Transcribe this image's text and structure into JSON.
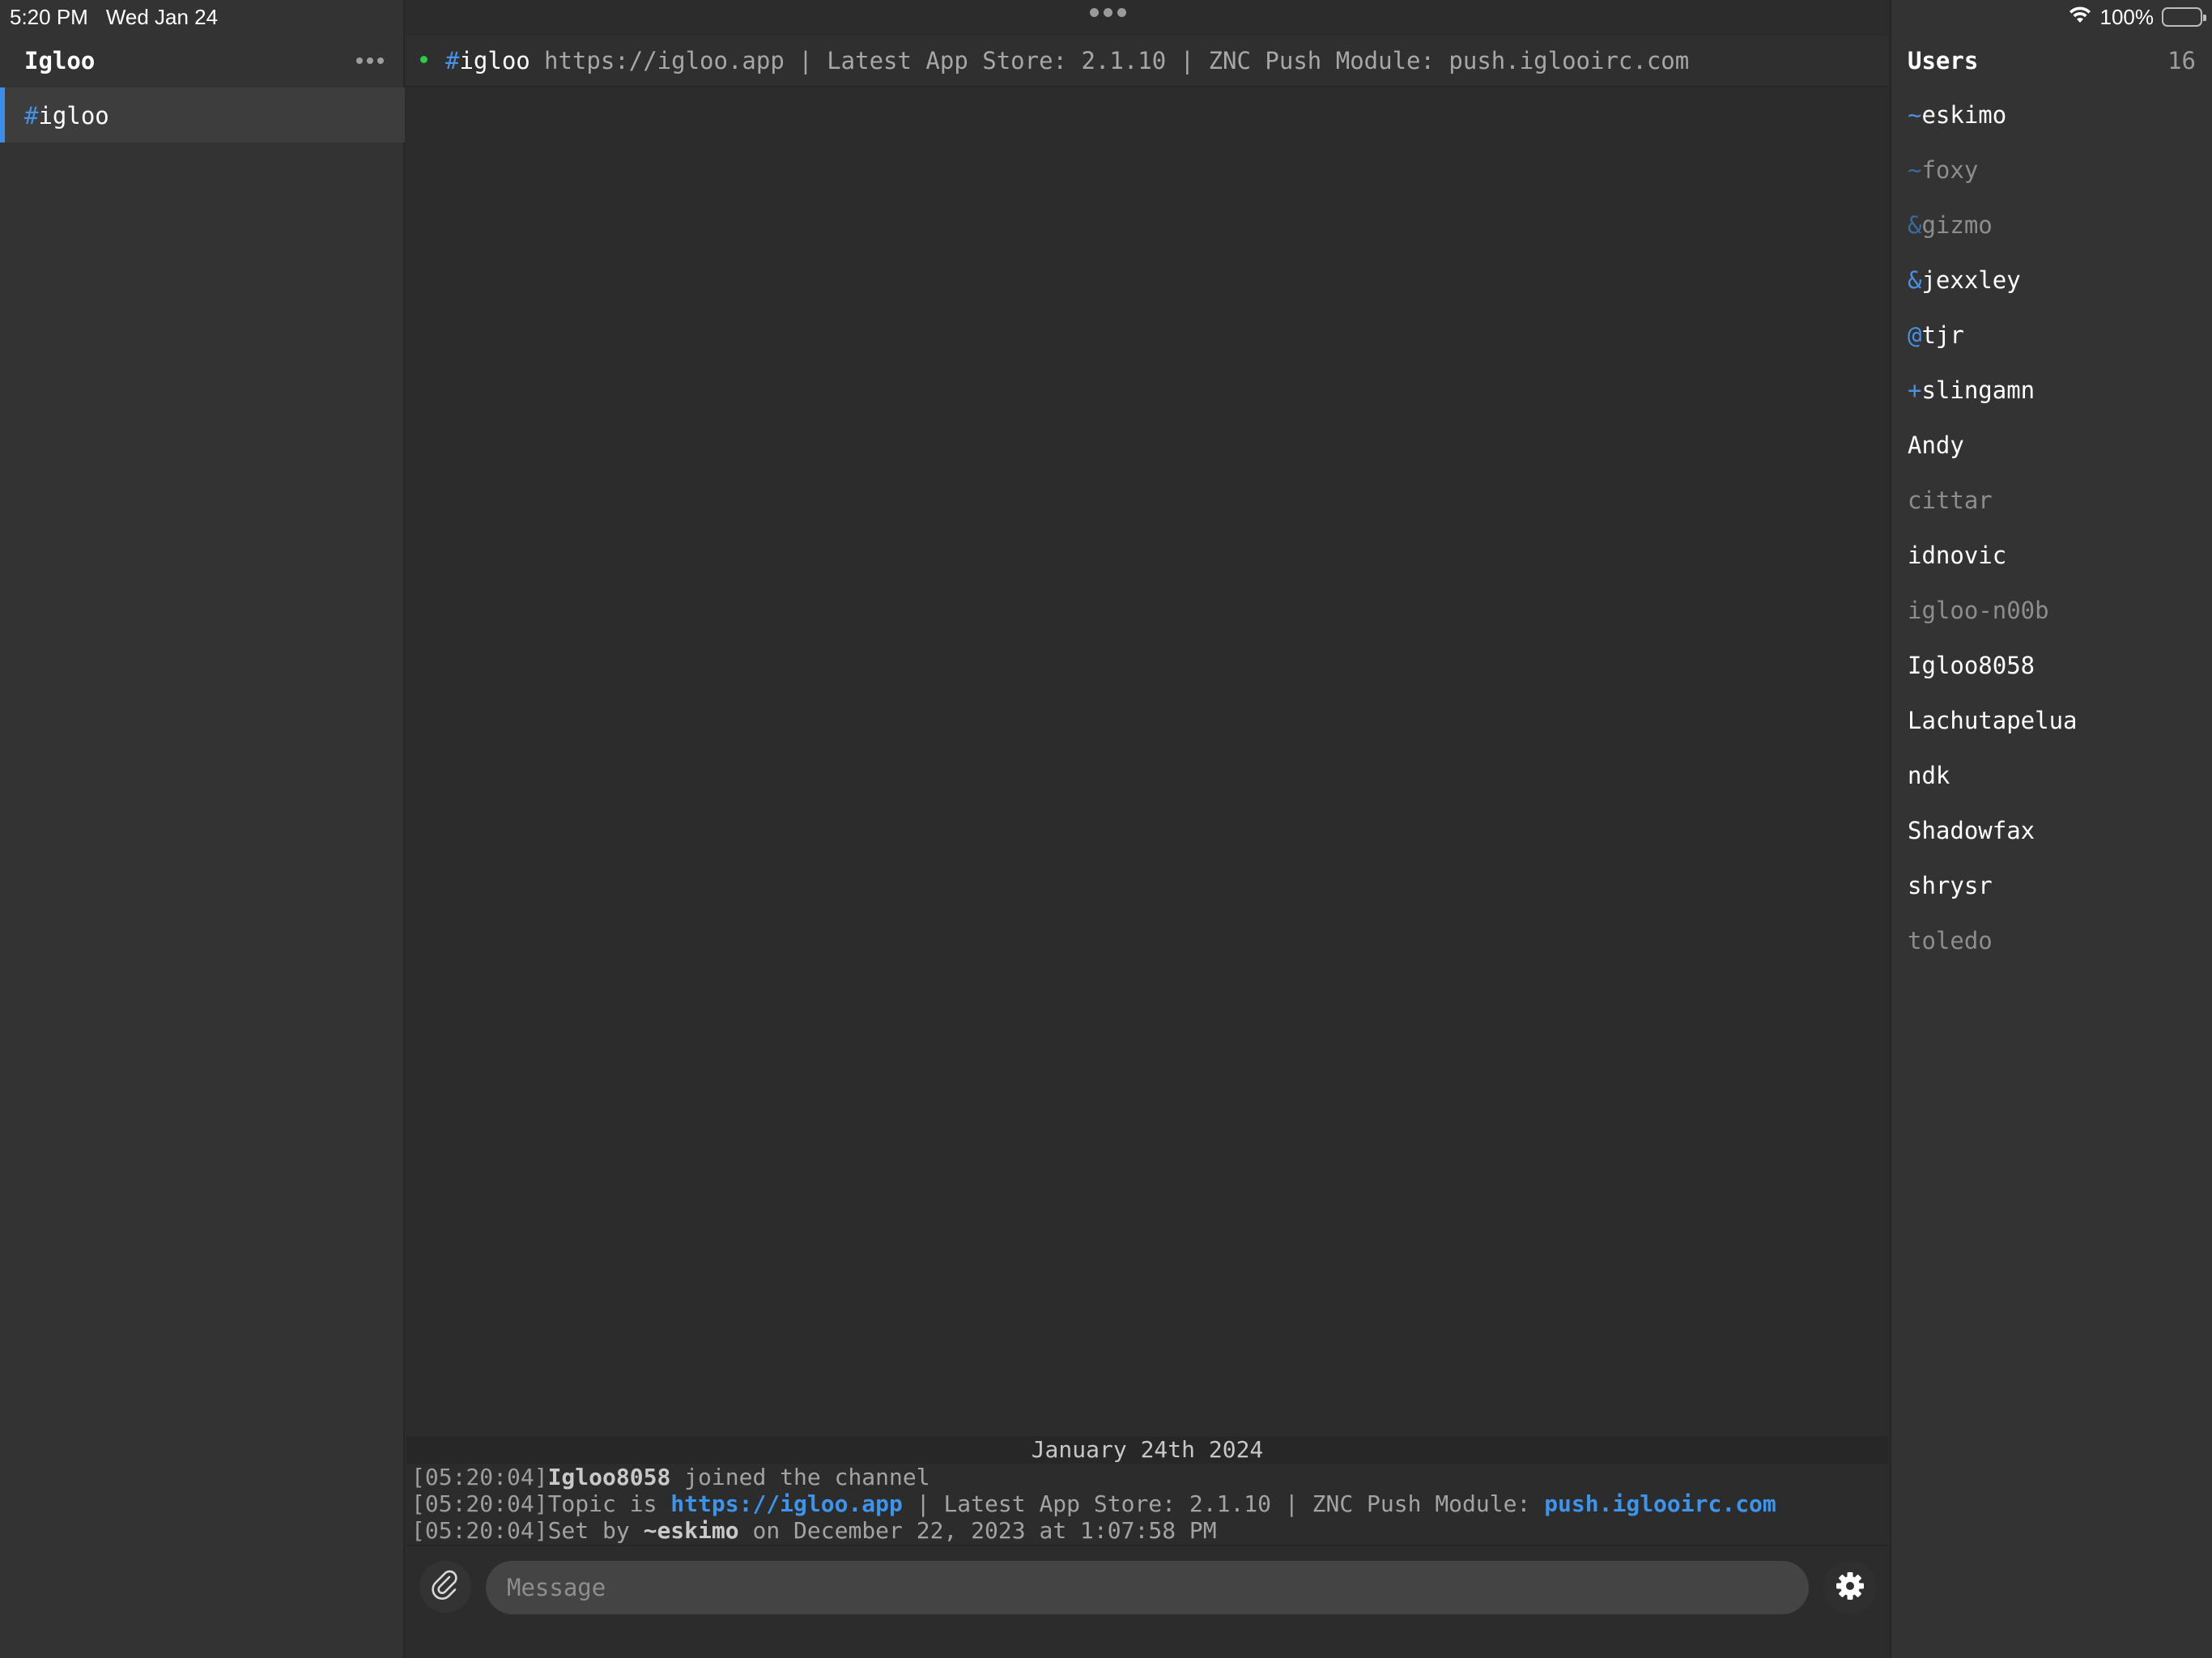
{
  "status_bar": {
    "time": "5:20 PM",
    "date": "Wed Jan 24",
    "battery": "100%"
  },
  "sidebar": {
    "title": "Igloo",
    "channels": [
      {
        "prefix": "#",
        "name": "igloo",
        "selected": true
      }
    ]
  },
  "topic_bar": {
    "channel": "#igloo",
    "topic": "https://igloo.app | Latest App Store: 2.1.10 | ZNC Push Module: push.iglooirc.com"
  },
  "chat": {
    "date_separator": "January 24th 2024",
    "messages": [
      {
        "timestamp": "[05:20:04]",
        "nick": "Igloo8058",
        "text": " joined the channel"
      },
      {
        "timestamp": "[05:20:04]",
        "pre": "Topic is ",
        "link1": "https://igloo.app",
        "mid": " | Latest App Store: 2.1.10 | ZNC Push Module: ",
        "link2": "push.iglooirc.com"
      },
      {
        "timestamp": "[05:20:04]",
        "pre": "Set by ",
        "nick": "~eskimo",
        "text": " on December 22, 2023 at 1:07:58 PM"
      }
    ]
  },
  "composer": {
    "placeholder": "Message"
  },
  "users": {
    "title": "Users",
    "count": "16",
    "list": [
      {
        "prefix": "~",
        "name": "eskimo",
        "active": true
      },
      {
        "prefix": "~",
        "name": "foxy",
        "active": false
      },
      {
        "prefix": "&",
        "name": "gizmo",
        "active": false
      },
      {
        "prefix": "&",
        "name": "jexxley",
        "active": true
      },
      {
        "prefix": "@",
        "name": "tjr",
        "active": true
      },
      {
        "prefix": "+",
        "name": "slingamn",
        "active": true
      },
      {
        "prefix": "",
        "name": "Andy",
        "active": true
      },
      {
        "prefix": "",
        "name": "cittar",
        "active": false
      },
      {
        "prefix": "",
        "name": "idnovic",
        "active": true
      },
      {
        "prefix": "",
        "name": "igloo-n00b",
        "active": false
      },
      {
        "prefix": "",
        "name": "Igloo8058",
        "active": true
      },
      {
        "prefix": "",
        "name": "Lachutapelua",
        "active": true
      },
      {
        "prefix": "",
        "name": "ndk",
        "active": true
      },
      {
        "prefix": "",
        "name": "Shadowfax",
        "active": true
      },
      {
        "prefix": "",
        "name": "shrysr",
        "active": true
      },
      {
        "prefix": "",
        "name": "toledo",
        "active": false
      }
    ]
  },
  "colors": {
    "accent": "#3d8ee6",
    "online": "#2ecc40",
    "link": "#3e93ea"
  }
}
